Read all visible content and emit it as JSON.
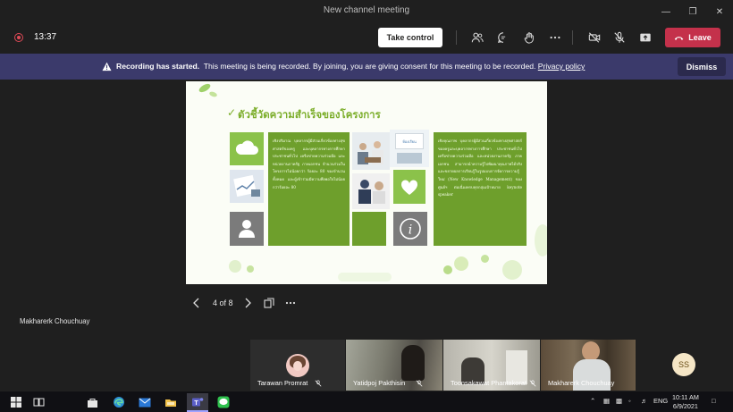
{
  "window": {
    "title": "New channel meeting"
  },
  "toolbar": {
    "time": "13:37",
    "take_control_label": "Take control",
    "leave_label": "Leave"
  },
  "banner": {
    "bold": "Recording has started.",
    "text": "This meeting is being recorded. By joining, you are giving consent for this meeting to be recorded.",
    "policy_link": "Privacy policy",
    "dismiss_label": "Dismiss"
  },
  "slide": {
    "title": "ตัวชี้วัดความสำเร็จของโครงการ",
    "left_text": "เชิงปริมาณ บุคลากรผู้มีส่วนเกี่ยวข้องทางสุขศาสตร์ของครู และบุคลากรทางการศึกษา ประชาชนทั่วไป เครือข่ายความร่วมมือ และหน่วยงานภาครัฐ ภาคเอกชน จำนวนร่วมในโครงการไม่น้อยกว่า ร้อยละ 80 ของจำนวนทั้งหมด และผู้เข้าร่วมมีความพึงพอใจไม่น้อยกว่าร้อยละ 80",
    "right_text": "เชิงคุณภาพ บุคลากรผู้มีส่วนเกี่ยวข้องทางสุขศาสตร์ของครูและบุคลากรทางการศึกษา ประชาชนทั่วไป เครือข่ายความร่วมมือ และหน่วยงานภาครัฐ ภาคเอกชน สามารถนำความรู้ไปพัฒนาคุณภาพได้จริง และขยายผลการเรียนรู้ในรูปแบบการจัดการความรู้ใหม่ (New Knowledge Management) ของศูนย์ฯ ต่อเนื่องครบทุกกลุ่มเป้าหมาย keynote speaker",
    "photo_label": "ห้องเรียน"
  },
  "slide_nav": {
    "counter": "4 of 8"
  },
  "presenter": {
    "name": "Makharerk Chouchuay"
  },
  "participants": [
    {
      "name": "Tarawan Promrat"
    },
    {
      "name": "Yatidpoj Pakthisin"
    },
    {
      "name": "Toonsakawat Phantakorat"
    },
    {
      "name": "Makharerk Chouchuay"
    }
  ],
  "avatar_initials": "SS",
  "taskbar": {
    "lang": "ENG",
    "time": "10:11 AM",
    "date": "6/9/2021"
  },
  "colors": {
    "leave": "#c4314b",
    "banner": "#3b3a6b",
    "slide_green": "#6e9f2c",
    "slide_light_green": "#8bc24a"
  }
}
